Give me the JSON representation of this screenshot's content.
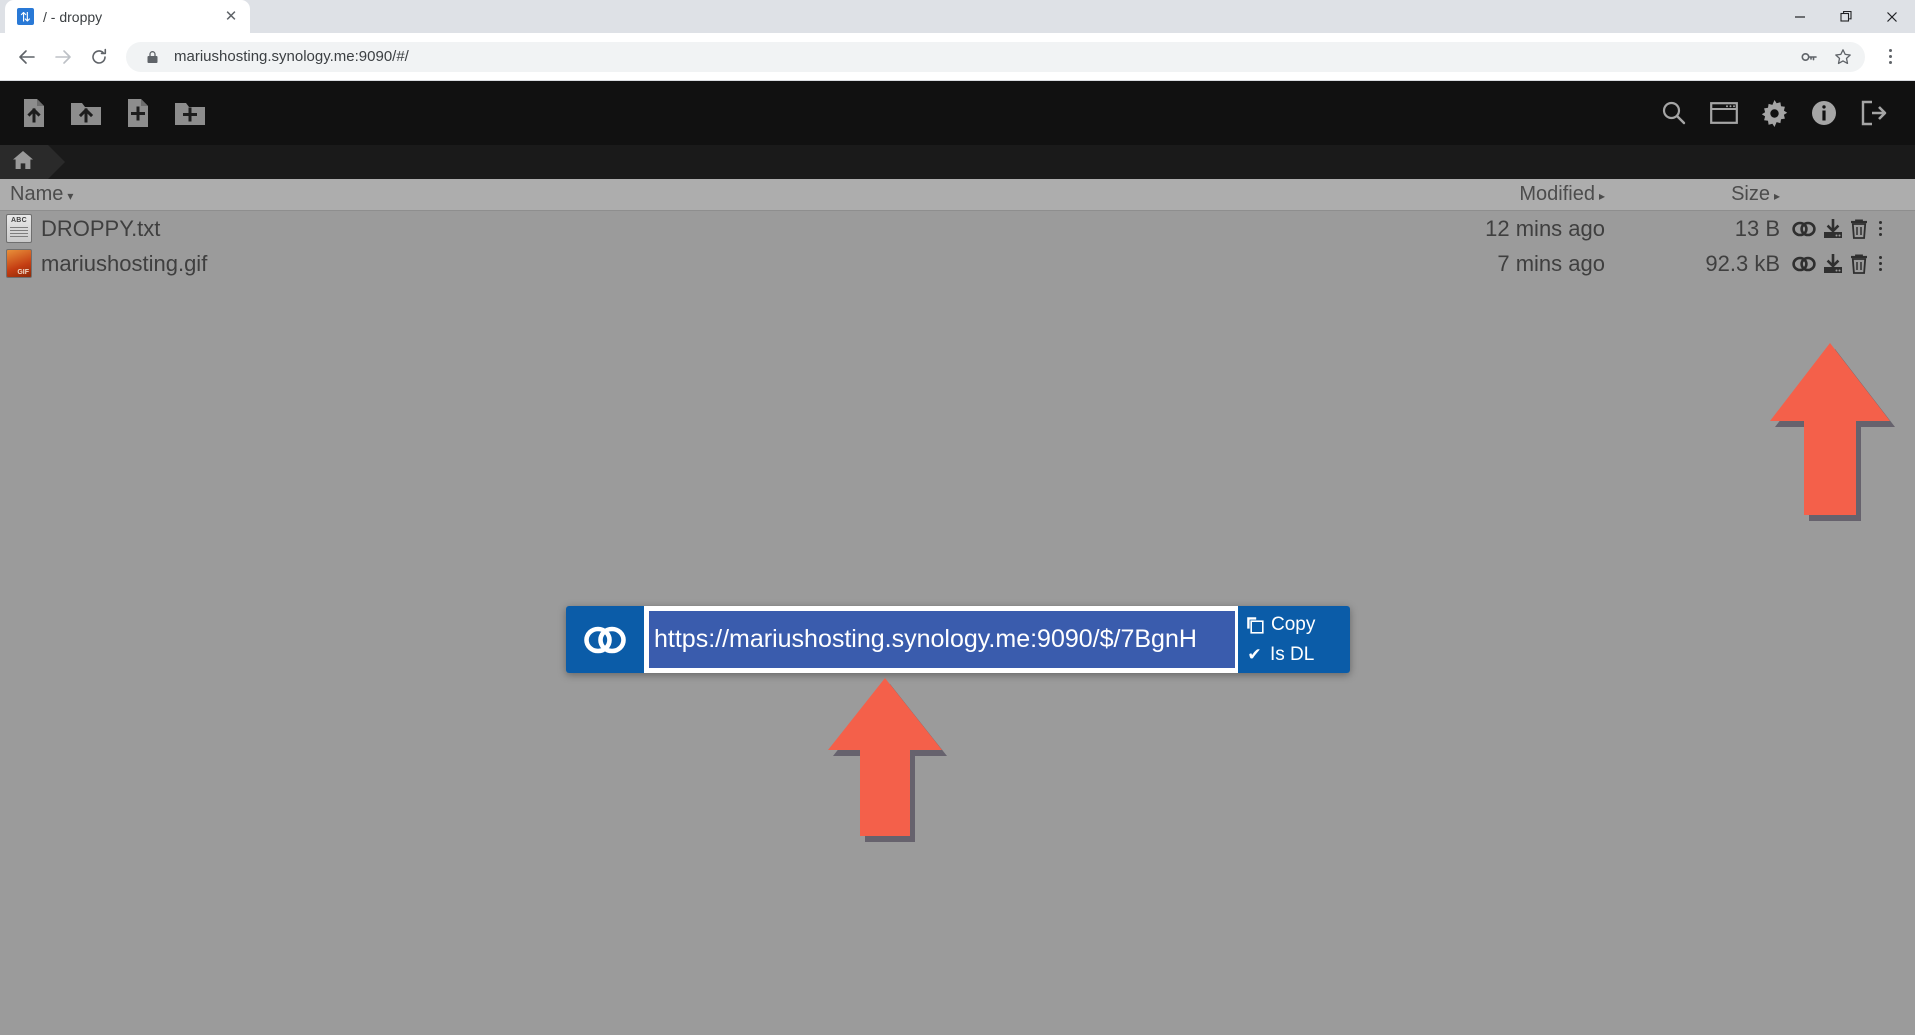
{
  "browser": {
    "tab": {
      "title": "/ - droppy",
      "favicon_icon": "droppy-favicon",
      "close_icon": "close-icon"
    },
    "window_controls": {
      "minimize": "—",
      "maximize": "❐",
      "close": "✕"
    },
    "nav": {
      "back_icon": "back-arrow-icon",
      "forward_icon": "forward-arrow-icon",
      "reload_icon": "reload-icon"
    },
    "omnibox": {
      "lock_icon": "lock-icon",
      "url": "mariushosting.synology.me:9090/#/",
      "key_icon": "key-icon",
      "star_icon": "star-icon"
    },
    "menu_icon": "chrome-menu-icon"
  },
  "app": {
    "toolbar_left": [
      {
        "name": "upload-file-button",
        "icon": "file-upload-icon"
      },
      {
        "name": "upload-folder-button",
        "icon": "folder-upload-icon"
      },
      {
        "name": "create-file-button",
        "icon": "file-add-icon"
      },
      {
        "name": "create-folder-button",
        "icon": "folder-add-icon"
      }
    ],
    "toolbar_right": [
      {
        "name": "search-button",
        "icon": "search-icon"
      },
      {
        "name": "media-view-button",
        "icon": "window-icon"
      },
      {
        "name": "settings-button",
        "icon": "gear-icon"
      },
      {
        "name": "about-button",
        "icon": "info-icon"
      },
      {
        "name": "logout-button",
        "icon": "logout-icon"
      }
    ],
    "breadcrumb": {
      "home_icon": "home-icon",
      "path": "/"
    },
    "columns": {
      "name": "Name",
      "modified": "Modified",
      "size": "Size",
      "sort_caret_name": "▾",
      "sort_caret_other": "▸"
    },
    "files": [
      {
        "name": "DROPPY.txt",
        "icon": "text-file-icon",
        "modified": "12 mins ago",
        "size": "13 B",
        "actions": [
          "link-icon",
          "download-icon",
          "delete-icon",
          "more-icon"
        ]
      },
      {
        "name": "mariushosting.gif",
        "icon": "gif-file-icon",
        "modified": "7 mins ago",
        "size": "92.3 kB",
        "actions": [
          "link-icon",
          "download-icon",
          "delete-icon",
          "more-icon"
        ]
      }
    ]
  },
  "share_dialog": {
    "link_icon": "chain-link-icon",
    "url": "https://mariushosting.synology.me:9090/$/7BgnH",
    "copy_label": "Copy",
    "copy_icon": "copy-icon",
    "isdl_label": "Is DL",
    "isdl_check": "✔"
  },
  "annotations": [
    {
      "name": "arrow-to-link-button",
      "color": "#f4604a"
    },
    {
      "name": "arrow-to-url-field",
      "color": "#f4604a"
    }
  ],
  "colors": {
    "app_background": "#9b9b9b",
    "app_header": "#111111",
    "dialog_blue": "#0b5ca8",
    "selection_blue": "#3a5cad",
    "arrow_red": "#f4604a"
  }
}
